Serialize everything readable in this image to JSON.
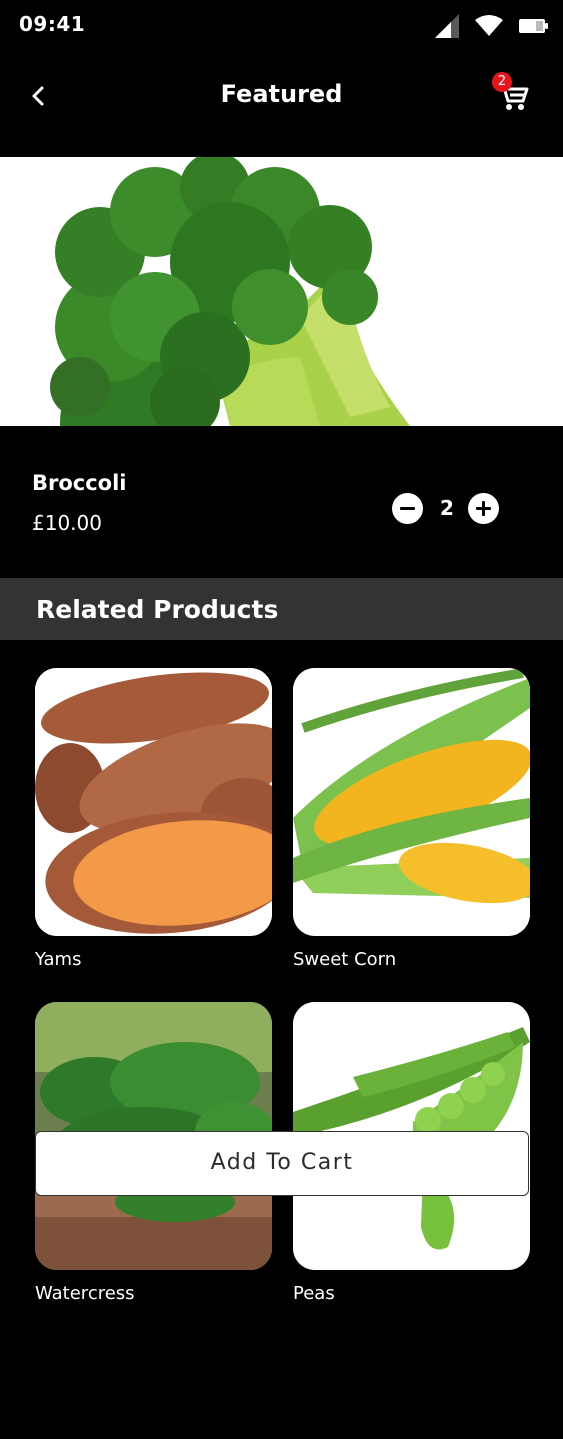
{
  "status": {
    "time": "09:41"
  },
  "header": {
    "title": "Featured",
    "cart_count": "2"
  },
  "product": {
    "name": "Broccoli",
    "price": "£10.00",
    "quantity": "2"
  },
  "related": {
    "title": "Related Products",
    "items": [
      {
        "label": "Yams"
      },
      {
        "label": "Sweet Corn"
      },
      {
        "label": "Watercress"
      },
      {
        "label": "Peas"
      }
    ]
  },
  "actions": {
    "add_to_cart": "Add To Cart"
  },
  "icons": {
    "back": "chevron-left-icon",
    "cart": "shopping-cart-icon",
    "minus": "minus-circle-icon",
    "plus": "plus-circle-icon"
  },
  "colors": {
    "badge": "#e8141c",
    "section_bar": "#333333",
    "background": "#000000"
  }
}
